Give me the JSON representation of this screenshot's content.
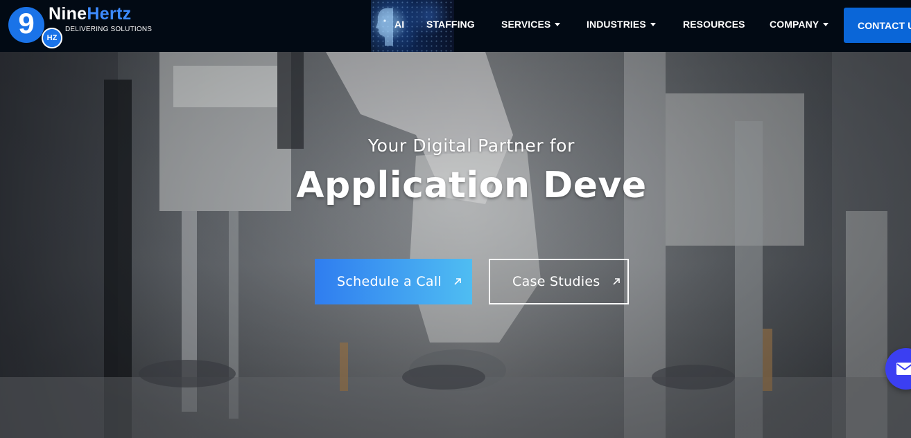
{
  "brand": {
    "logo_digit": "9",
    "logo_hz": "HZ",
    "name_part1": "Nine",
    "name_part2": "Hertz",
    "tagline": "DELIVERING SOLUTIONS",
    "accent_color": "#1a73e8"
  },
  "nav": {
    "ai": {
      "label": "AI",
      "icon": "ai-head-icon"
    },
    "items": [
      {
        "label": "STAFFING",
        "has_dropdown": false
      },
      {
        "label": "SERVICES",
        "has_dropdown": true
      },
      {
        "label": "INDUSTRIES",
        "has_dropdown": true
      },
      {
        "label": "RESOURCES",
        "has_dropdown": false
      },
      {
        "label": "COMPANY",
        "has_dropdown": true
      }
    ],
    "contact_label": "CONTACT US",
    "contact_color": "#0a66d8",
    "dropdown_icon": "chevron-down-icon"
  },
  "hero": {
    "subtitle": "Your Digital Partner for",
    "title": "Application Deve",
    "primary_button": "Schedule a Call",
    "secondary_button": "Case Studies",
    "button_icon": "arrow-up-right-icon",
    "primary_gradient": [
      "#2f7df0",
      "#4fbdf2"
    ]
  },
  "floating": {
    "icon": "mail-icon",
    "color": "#3b3ff2"
  }
}
